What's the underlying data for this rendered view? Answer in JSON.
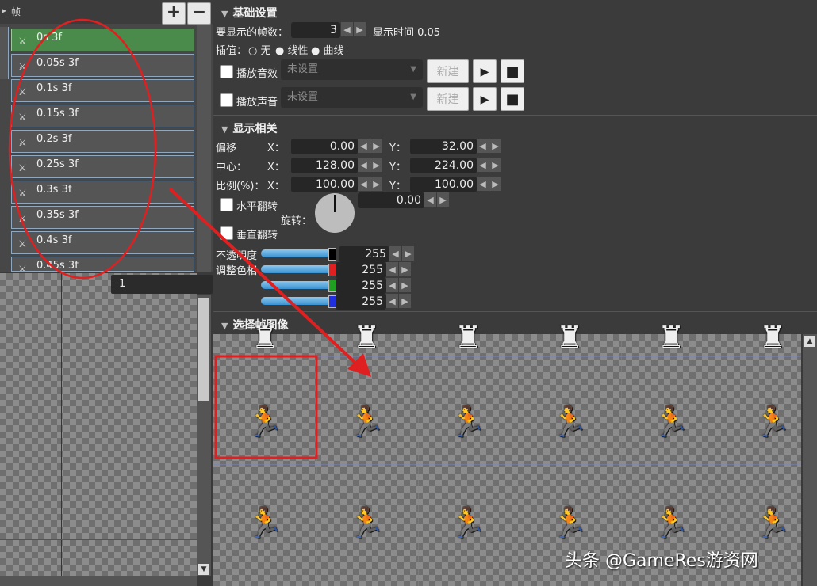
{
  "left": {
    "header_label": "帧",
    "add_label": "+",
    "remove_label": "−",
    "frames": [
      {
        "label": "0s 3f"
      },
      {
        "label": "0.05s 3f"
      },
      {
        "label": "0.1s 3f"
      },
      {
        "label": "0.15s 3f"
      },
      {
        "label": "0.2s 3f"
      },
      {
        "label": "0.25s 3f"
      },
      {
        "label": "0.3s 3f"
      },
      {
        "label": "0.35s 3f"
      },
      {
        "label": "0.4s 3f"
      },
      {
        "label": "0.45s 3f"
      }
    ],
    "selected_frame": 0,
    "layer_select_value": "1"
  },
  "basic": {
    "title": "基础设置",
    "frame_count_label": "要显示的帧数：",
    "frame_count_value": "3",
    "display_time_label": "显示时间 0.05",
    "interp_label": "插值：",
    "interp_options": [
      "无",
      "线性",
      "曲线"
    ],
    "sfx_label": "播放音效",
    "sfx_value": "未设置",
    "voice_label": "播放声音",
    "voice_value": "未设置",
    "new_label": "新建"
  },
  "display": {
    "title": "显示相关",
    "offset_label": "偏移",
    "center_label": "中心：",
    "scale_label": "比例(%)：",
    "x_label": "X：",
    "y_label": "Y：",
    "offset_x": "0.00",
    "offset_y": "32.00",
    "center_x": "128.00",
    "center_y": "224.00",
    "scale_x": "100.00",
    "scale_y": "100.00",
    "hflip_label": "水平翻转",
    "vflip_label": "垂直翻转",
    "rotate_label": "旋转：",
    "rotate_value": "0.00",
    "opacity_label": "不透明度",
    "tint_label": "调整色相",
    "opacity_value": "255",
    "red_value": "255",
    "green_value": "255",
    "blue_value": "255",
    "colors": {
      "opacity": "#000000",
      "red": "#e02020",
      "green": "#20a020",
      "blue": "#2030e0"
    }
  },
  "select_image": {
    "title": "选择帧图像",
    "sprite_icon": "running-soldier-sprite"
  },
  "watermark": "头条 @GameRes游资网",
  "annotation_color": "#e02020"
}
